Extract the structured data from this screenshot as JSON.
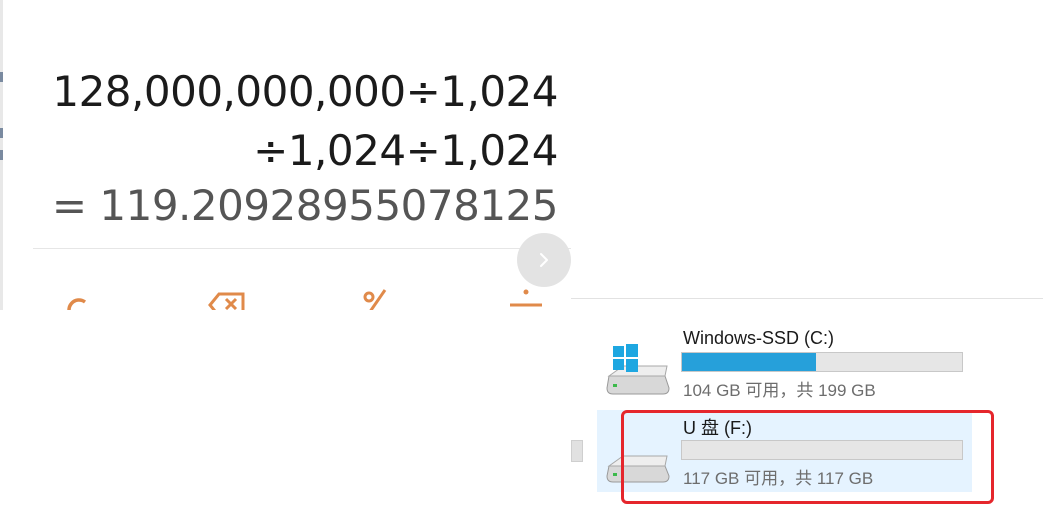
{
  "calculator": {
    "expression_line1": "128,000,000,000÷1,024",
    "expression_line2": "÷1,024÷1,024",
    "result": "= 119.20928955078125",
    "keys": [
      "clear-key",
      "backspace-key",
      "percent-key",
      "divide-key"
    ],
    "accent_color": "#e08a4a",
    "next_button_icon": "chevron-right-icon"
  },
  "drives": [
    {
      "name": "Windows-SSD (C:)",
      "space_text": "104 GB 可用，共 199 GB",
      "used_fraction": 0.477,
      "icon": "windows-drive-icon",
      "selected": false
    },
    {
      "name": "U 盘 (F:)",
      "space_text": "117 GB 可用，共 117 GB",
      "used_fraction": 0.0,
      "icon": "usb-drive-icon",
      "selected": true
    }
  ],
  "colors": {
    "bar_fill": "#26a0da",
    "selection": "#e5f3ff",
    "highlight": "#e5262c"
  }
}
